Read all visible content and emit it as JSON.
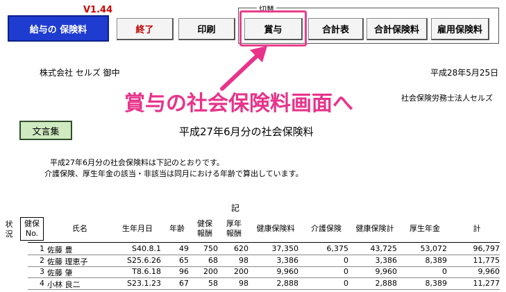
{
  "toolbar": {
    "version": "V1.44",
    "main_button": "給与の 保険料",
    "exit_button": "終了",
    "print_button": "印刷",
    "switch_group_title": "切替",
    "bonus_button": "賞与",
    "total_table_button": "合計表",
    "total_insurance_button": "合計保険料",
    "employment_insurance_button": "雇用保険料"
  },
  "letter": {
    "addressee": "株式会社 セルズ 御中",
    "date": "平成28年5月25日",
    "sender": "社会保険労務士法人セルズ",
    "title": "平成27年6月分の社会保険料",
    "body_line1": "平成27年6月分の社会保険料は下記のとおりです。",
    "body_line2": "介護保険、厚生年金の該当・非該当は同月における年齢で算出しています。",
    "ki": "記"
  },
  "bunsho_button": "文言集",
  "annotation": {
    "callout_text": "賞与の社会保険料画面へ",
    "arrow_color": "#e8338a"
  },
  "table": {
    "headers": {
      "status": "状況",
      "no_line1": "健保",
      "no_line2": "No.",
      "name": "氏名",
      "birthday": "生年月日",
      "age": "年齢",
      "kenpo_line1": "健保",
      "kenpo_line2": "報酬",
      "kosei_line1": "厚年",
      "kosei_line2": "報酬",
      "health_ins": "健康保険料",
      "care_ins": "介護保険",
      "health_total": "健康保険計",
      "pension": "厚生年金",
      "total": "計"
    },
    "rows": [
      {
        "no": "1",
        "name": "佐藤 豊",
        "birthday": "S40.8.1",
        "age": "49",
        "kenpo": "750",
        "kosei": "620",
        "health": "37,350",
        "care": "6,375",
        "health_total": "43,725",
        "pension": "53,072",
        "total": "96,797"
      },
      {
        "no": "2",
        "name": "佐藤 理恵子",
        "birthday": "S25.6.26",
        "age": "65",
        "kenpo": "68",
        "kosei": "98",
        "health": "3,386",
        "care": "0",
        "health_total": "3,386",
        "pension": "8,389",
        "total": "11,775"
      },
      {
        "no": "3",
        "name": "佐藤 肇",
        "birthday": "T8.6.18",
        "age": "96",
        "kenpo": "200",
        "kosei": "200",
        "health": "9,960",
        "care": "0",
        "health_total": "9,960",
        "pension": "0",
        "total": "9,960"
      },
      {
        "no": "4",
        "name": "小林 良二",
        "birthday": "S23.1.23",
        "age": "67",
        "kenpo": "58",
        "kosei": "98",
        "health": "2,888",
        "care": "0",
        "health_total": "2,888",
        "pension": "8,389",
        "total": "11,277"
      }
    ]
  },
  "colors": {
    "main_button": "#1e3ccf",
    "exit_text": "#c00000",
    "highlight": "#e83e8c",
    "bunsho_bg": "#cfe9c0"
  }
}
